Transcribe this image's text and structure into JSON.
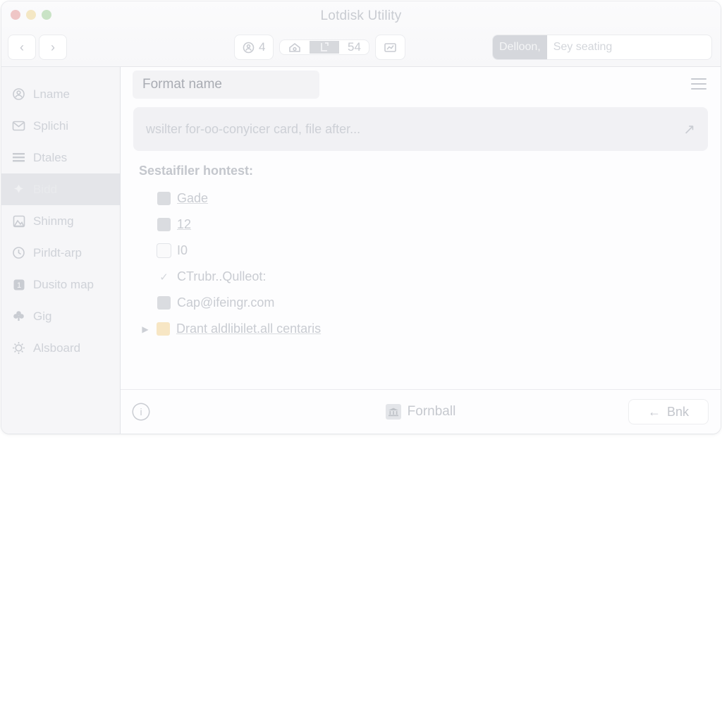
{
  "window": {
    "title": "Lotdisk Utility",
    "traffic_lights": [
      {
        "name": "close-button",
        "color": "#e8a3a3"
      },
      {
        "name": "minimize-button",
        "color": "#f0dba0"
      },
      {
        "name": "zoom-button",
        "color": "#a8d4a2"
      }
    ]
  },
  "toolbar": {
    "back_icon": "‹",
    "forward_icon": "›",
    "count_badge": "4",
    "segment_value": "54",
    "icons": {
      "badge": "circle-person-icon",
      "home": "home-icon",
      "active": "export-icon",
      "trailing": "chart-icon"
    }
  },
  "search": {
    "token": "Delloon,",
    "placeholder": "Sey seating",
    "value": ""
  },
  "sidebar": {
    "items": [
      {
        "label": "Lname",
        "icon": "gear-person-icon",
        "selected": false
      },
      {
        "label": "Splichi",
        "icon": "mail-icon",
        "selected": false
      },
      {
        "label": "Dtales",
        "icon": "list-lines-icon",
        "selected": false
      },
      {
        "label": "Bidd",
        "icon": "pin-icon",
        "selected": true
      },
      {
        "label": "Shinmg",
        "icon": "image-icon",
        "selected": false
      },
      {
        "label": "Pirldt-arp",
        "icon": "clock-icon",
        "selected": false
      },
      {
        "label": "Dusito map",
        "icon": "number-one-icon",
        "selected": false
      },
      {
        "label": "Gig",
        "icon": "clover-icon",
        "selected": false
      },
      {
        "label": "Alsboard",
        "icon": "sun-icon",
        "selected": false
      }
    ]
  },
  "main": {
    "panel_title": "Format name",
    "menu_icon": "hamburger-menu-icon",
    "filter": {
      "placeholder": "wsilter for-oo-conyicer card, file after...",
      "value": "",
      "arrow_icon": "arrow-up-right-icon"
    },
    "list_heading": "Sestaifiler hontest:",
    "rows": [
      {
        "label": "Gade",
        "icon": "square-filled-icon",
        "underline": true,
        "disclosure": false,
        "indent": true
      },
      {
        "label": "12",
        "icon": "image-square-icon",
        "underline": true,
        "disclosure": false,
        "indent": true
      },
      {
        "label": "I0",
        "icon": "blank-square-icon",
        "underline": false,
        "disclosure": false,
        "indent": true
      },
      {
        "label": "CTrubr..Qulleot:",
        "icon": "checkmark-icon",
        "underline": false,
        "disclosure": false,
        "indent": true
      },
      {
        "label": "Cap@ifeingr.com",
        "icon": "square-filled-icon",
        "underline": false,
        "disclosure": false,
        "indent": true
      },
      {
        "label": "Drant aldlibilet.all centaris",
        "icon": "folder-icon",
        "underline": true,
        "disclosure": true,
        "indent": false
      }
    ]
  },
  "footer": {
    "info_icon": "info-icon",
    "info_glyph": "i",
    "center_label": "Fornball",
    "center_icon": "bank-icon",
    "back_button": {
      "arrow": "←",
      "label": "Bnk"
    }
  }
}
